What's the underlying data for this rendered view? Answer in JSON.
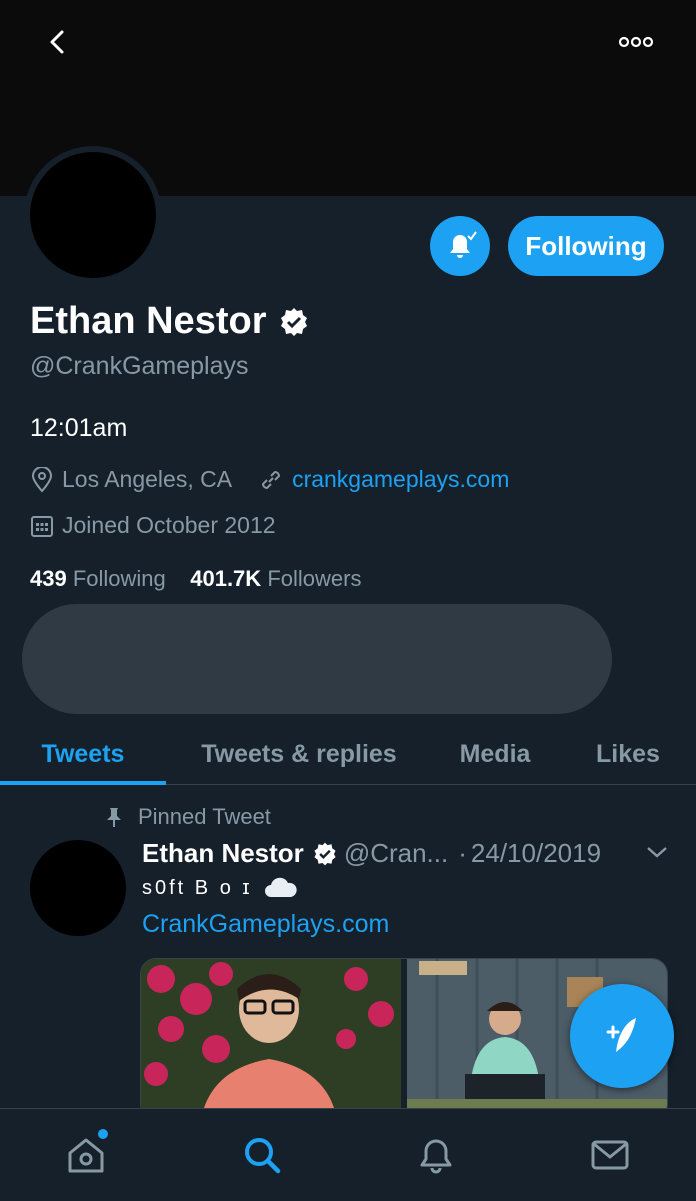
{
  "header": {
    "back_icon": "chevron-left-icon",
    "more_icon": "more-horizontal-icon"
  },
  "profile": {
    "name": "Ethan Nestor",
    "handle": "@CrankGameplays",
    "bio": "12:01am",
    "location": "Los Angeles, CA",
    "website": "crankgameplays.com",
    "joined": "Joined October 2012",
    "following_count": "439",
    "following_label": "Following",
    "followers_count": "401.7K",
    "followers_label": "Followers",
    "follow_button": "Following"
  },
  "tabs": [
    {
      "label": "Tweets",
      "active": true
    },
    {
      "label": "Tweets & replies",
      "active": false
    },
    {
      "label": "Media",
      "active": false
    },
    {
      "label": "Likes",
      "active": false
    }
  ],
  "tweet": {
    "pinned_label": "Pinned Tweet",
    "author": "Ethan Nestor",
    "handle": "@Cran...",
    "separator": "·",
    "date": "24/10/2019",
    "text": "s0ft B o ɪ",
    "link": "CrankGameplays.com"
  },
  "nav": [
    {
      "icon": "home-icon",
      "has_dot": true
    },
    {
      "icon": "search-icon",
      "active": true
    },
    {
      "icon": "notifications-icon"
    },
    {
      "icon": "messages-icon"
    }
  ],
  "colors": {
    "accent": "#1da1f2",
    "background": "#15202b",
    "muted": "#8899a6",
    "divider": "#38444d"
  }
}
